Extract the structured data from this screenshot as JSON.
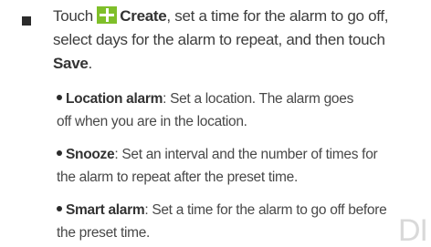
{
  "main_item": {
    "prefix": "Touch ",
    "create_label": "Create",
    "text_middle": ", set a time for the alarm to go off, select days for the alarm to repeat, and then touch ",
    "save_label": "Save",
    "suffix": "."
  },
  "sub_items": [
    {
      "term": "Location alarm",
      "line1": ": Set a location. The alarm goes",
      "line2": "off when you are in the location."
    },
    {
      "term": "Snooze",
      "line1": ": Set an interval and the number of times for",
      "line2": "the alarm to repeat after the preset time."
    },
    {
      "term": "Smart alarm",
      "line1": ": Set a time for the alarm to go off before",
      "line2": "the preset time."
    }
  ],
  "watermark": "DI",
  "colors": {
    "create_icon": "#7fbf2a",
    "text": "#3d3d3d"
  },
  "icons": {
    "create": "plus-icon",
    "bullet": "square-bullet-icon"
  }
}
